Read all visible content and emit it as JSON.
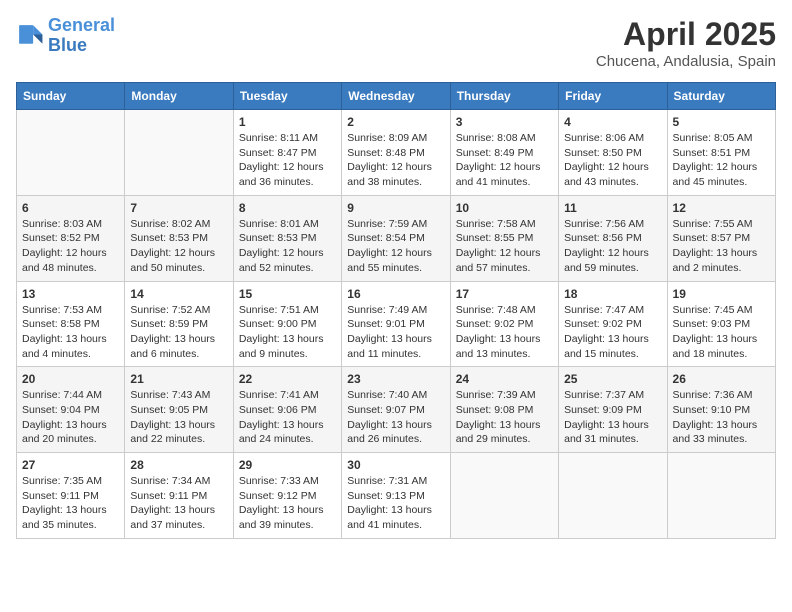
{
  "logo": {
    "line1": "General",
    "line2": "Blue"
  },
  "title": "April 2025",
  "subtitle": "Chucena, Andalusia, Spain",
  "headers": [
    "Sunday",
    "Monday",
    "Tuesday",
    "Wednesday",
    "Thursday",
    "Friday",
    "Saturday"
  ],
  "weeks": [
    [
      {
        "day": "",
        "info": ""
      },
      {
        "day": "",
        "info": ""
      },
      {
        "day": "1",
        "info": "Sunrise: 8:11 AM\nSunset: 8:47 PM\nDaylight: 12 hours and 36 minutes."
      },
      {
        "day": "2",
        "info": "Sunrise: 8:09 AM\nSunset: 8:48 PM\nDaylight: 12 hours and 38 minutes."
      },
      {
        "day": "3",
        "info": "Sunrise: 8:08 AM\nSunset: 8:49 PM\nDaylight: 12 hours and 41 minutes."
      },
      {
        "day": "4",
        "info": "Sunrise: 8:06 AM\nSunset: 8:50 PM\nDaylight: 12 hours and 43 minutes."
      },
      {
        "day": "5",
        "info": "Sunrise: 8:05 AM\nSunset: 8:51 PM\nDaylight: 12 hours and 45 minutes."
      }
    ],
    [
      {
        "day": "6",
        "info": "Sunrise: 8:03 AM\nSunset: 8:52 PM\nDaylight: 12 hours and 48 minutes."
      },
      {
        "day": "7",
        "info": "Sunrise: 8:02 AM\nSunset: 8:53 PM\nDaylight: 12 hours and 50 minutes."
      },
      {
        "day": "8",
        "info": "Sunrise: 8:01 AM\nSunset: 8:53 PM\nDaylight: 12 hours and 52 minutes."
      },
      {
        "day": "9",
        "info": "Sunrise: 7:59 AM\nSunset: 8:54 PM\nDaylight: 12 hours and 55 minutes."
      },
      {
        "day": "10",
        "info": "Sunrise: 7:58 AM\nSunset: 8:55 PM\nDaylight: 12 hours and 57 minutes."
      },
      {
        "day": "11",
        "info": "Sunrise: 7:56 AM\nSunset: 8:56 PM\nDaylight: 12 hours and 59 minutes."
      },
      {
        "day": "12",
        "info": "Sunrise: 7:55 AM\nSunset: 8:57 PM\nDaylight: 13 hours and 2 minutes."
      }
    ],
    [
      {
        "day": "13",
        "info": "Sunrise: 7:53 AM\nSunset: 8:58 PM\nDaylight: 13 hours and 4 minutes."
      },
      {
        "day": "14",
        "info": "Sunrise: 7:52 AM\nSunset: 8:59 PM\nDaylight: 13 hours and 6 minutes."
      },
      {
        "day": "15",
        "info": "Sunrise: 7:51 AM\nSunset: 9:00 PM\nDaylight: 13 hours and 9 minutes."
      },
      {
        "day": "16",
        "info": "Sunrise: 7:49 AM\nSunset: 9:01 PM\nDaylight: 13 hours and 11 minutes."
      },
      {
        "day": "17",
        "info": "Sunrise: 7:48 AM\nSunset: 9:02 PM\nDaylight: 13 hours and 13 minutes."
      },
      {
        "day": "18",
        "info": "Sunrise: 7:47 AM\nSunset: 9:02 PM\nDaylight: 13 hours and 15 minutes."
      },
      {
        "day": "19",
        "info": "Sunrise: 7:45 AM\nSunset: 9:03 PM\nDaylight: 13 hours and 18 minutes."
      }
    ],
    [
      {
        "day": "20",
        "info": "Sunrise: 7:44 AM\nSunset: 9:04 PM\nDaylight: 13 hours and 20 minutes."
      },
      {
        "day": "21",
        "info": "Sunrise: 7:43 AM\nSunset: 9:05 PM\nDaylight: 13 hours and 22 minutes."
      },
      {
        "day": "22",
        "info": "Sunrise: 7:41 AM\nSunset: 9:06 PM\nDaylight: 13 hours and 24 minutes."
      },
      {
        "day": "23",
        "info": "Sunrise: 7:40 AM\nSunset: 9:07 PM\nDaylight: 13 hours and 26 minutes."
      },
      {
        "day": "24",
        "info": "Sunrise: 7:39 AM\nSunset: 9:08 PM\nDaylight: 13 hours and 29 minutes."
      },
      {
        "day": "25",
        "info": "Sunrise: 7:37 AM\nSunset: 9:09 PM\nDaylight: 13 hours and 31 minutes."
      },
      {
        "day": "26",
        "info": "Sunrise: 7:36 AM\nSunset: 9:10 PM\nDaylight: 13 hours and 33 minutes."
      }
    ],
    [
      {
        "day": "27",
        "info": "Sunrise: 7:35 AM\nSunset: 9:11 PM\nDaylight: 13 hours and 35 minutes."
      },
      {
        "day": "28",
        "info": "Sunrise: 7:34 AM\nSunset: 9:11 PM\nDaylight: 13 hours and 37 minutes."
      },
      {
        "day": "29",
        "info": "Sunrise: 7:33 AM\nSunset: 9:12 PM\nDaylight: 13 hours and 39 minutes."
      },
      {
        "day": "30",
        "info": "Sunrise: 7:31 AM\nSunset: 9:13 PM\nDaylight: 13 hours and 41 minutes."
      },
      {
        "day": "",
        "info": ""
      },
      {
        "day": "",
        "info": ""
      },
      {
        "day": "",
        "info": ""
      }
    ]
  ]
}
